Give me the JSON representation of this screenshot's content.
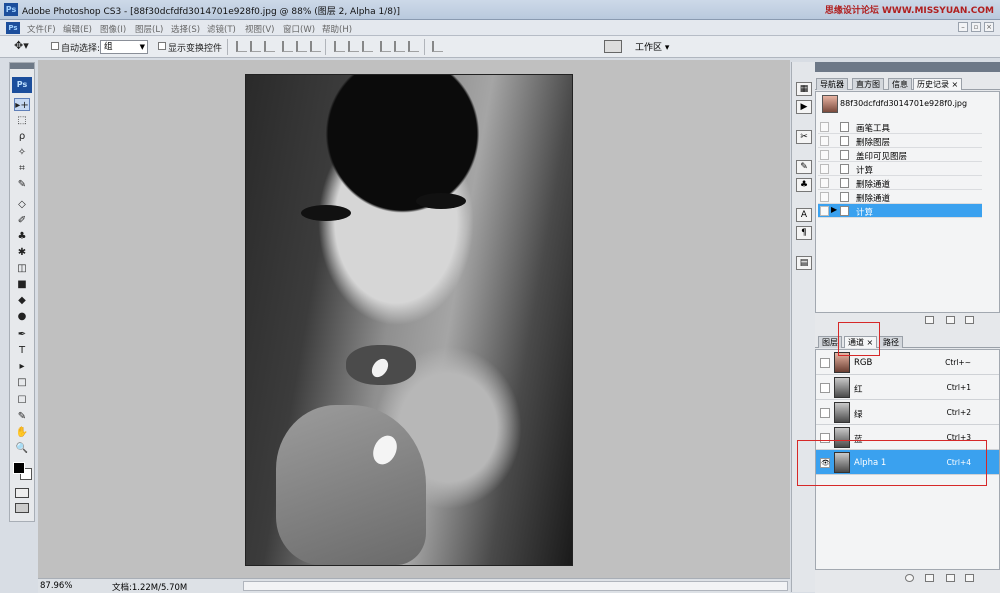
{
  "titlebar": {
    "logo": "Ps",
    "title": "Adobe Photoshop CS3 - [88f30dcfdfd3014701e928f0.jpg @ 88% (图层 2, Alpha 1/8)]",
    "watermark": "思缘设计论坛 WWW.MISSYUAN.COM"
  },
  "menubar": {
    "logo": "Ps",
    "items": [
      "文件(F)",
      "编辑(E)",
      "图像(I)",
      "图层(L)",
      "选择(S)",
      "滤镜(T)",
      "视图(V)",
      "窗口(W)",
      "帮助(H)"
    ]
  },
  "options": {
    "auto_select_label": "自动选择:",
    "auto_select_value": "组",
    "show_transform_label": "显示变换控件",
    "workspace_label": "工作区 ▾"
  },
  "toolbox": {
    "badge": "Ps",
    "tools": [
      "▸+",
      "⬚",
      "ρ",
      "✧",
      "⌗",
      "✎",
      "◇",
      "✐",
      "♣",
      "✱",
      "◫",
      "■",
      "◆",
      "●",
      "✒",
      "T",
      "▸",
      "□",
      "☐",
      "✎",
      "✋",
      "🔍"
    ]
  },
  "canvas": {
    "zoom": "87.96%",
    "doc_info": "文档:1.22M/5.70M"
  },
  "history_panel": {
    "tabs": [
      "导航器",
      "直方图",
      "信息",
      "历史记录"
    ],
    "active_tab": "历史记录",
    "source": "88f30dcfdfd3014701e928f0.jpg",
    "items": [
      "画笔工具",
      "删除图层",
      "盖印可见图层",
      "计算",
      "删除通道",
      "删除通道",
      "计算"
    ],
    "selected_index": 6
  },
  "channels_panel": {
    "tabs": [
      "图层",
      "通道",
      "路径"
    ],
    "active_tab": "通道",
    "channels": [
      {
        "name": "RGB",
        "shortcut": "Ctrl+~"
      },
      {
        "name": "红",
        "shortcut": "Ctrl+1"
      },
      {
        "name": "绿",
        "shortcut": "Ctrl+2"
      },
      {
        "name": "蓝",
        "shortcut": "Ctrl+3"
      },
      {
        "name": "Alpha 1",
        "shortcut": "Ctrl+4"
      }
    ],
    "selected_index": 4
  },
  "colors": {
    "selection_blue": "#3aa1ef",
    "highlight_red": "#d62828",
    "ps_blue": "#1c4e9c"
  }
}
